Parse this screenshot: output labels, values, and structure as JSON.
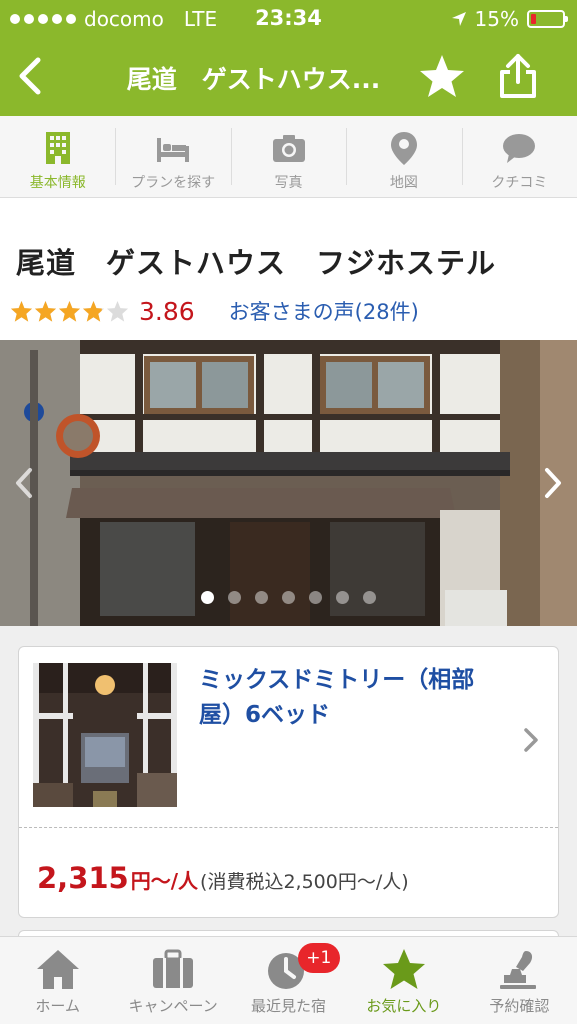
{
  "status_bar": {
    "carrier": "docomo",
    "network": "LTE",
    "time": "23:34",
    "battery_percent": "15%",
    "battery_level": 0.15
  },
  "nav": {
    "title": "尾道　ゲストハウス..."
  },
  "tabs": [
    {
      "label": "基本情報",
      "icon": "building-icon",
      "active": true
    },
    {
      "label": "プランを探す",
      "icon": "bed-icon",
      "active": false
    },
    {
      "label": "写真",
      "icon": "camera-icon",
      "active": false
    },
    {
      "label": "地図",
      "icon": "map-pin-icon",
      "active": false
    },
    {
      "label": "クチコミ",
      "icon": "speech-bubble-icon",
      "active": false
    }
  ],
  "hotel": {
    "name": "尾道　ゲストハウス　フジホステル",
    "rating": 3.86,
    "rating_text": "3.86",
    "reviews_link": "お客さまの声(28件)"
  },
  "photo_carousel": {
    "slide_count": 7,
    "current_slide": 1
  },
  "room": {
    "title": "ミックスドミトリー（相部屋）6ベッド",
    "price": "2,315",
    "price_unit": "円〜/人",
    "price_tax": "(消費税込2,500円〜/人)"
  },
  "bottom_bar": [
    {
      "label": "ホーム",
      "icon": "home-icon",
      "active": false
    },
    {
      "label": "キャンペーン",
      "icon": "briefcase-icon",
      "active": false
    },
    {
      "label": "最近見た宿",
      "icon": "clock-icon",
      "active": false,
      "badge": "+1"
    },
    {
      "label": "お気に入り",
      "icon": "star-icon",
      "active": true
    },
    {
      "label": "予約確認",
      "icon": "stamp-icon",
      "active": false
    }
  ],
  "colors": {
    "brand_green": "#8bb82c",
    "price_red": "#c4161c",
    "link_blue": "#2a5db0",
    "star_gold": "#f5a623"
  }
}
